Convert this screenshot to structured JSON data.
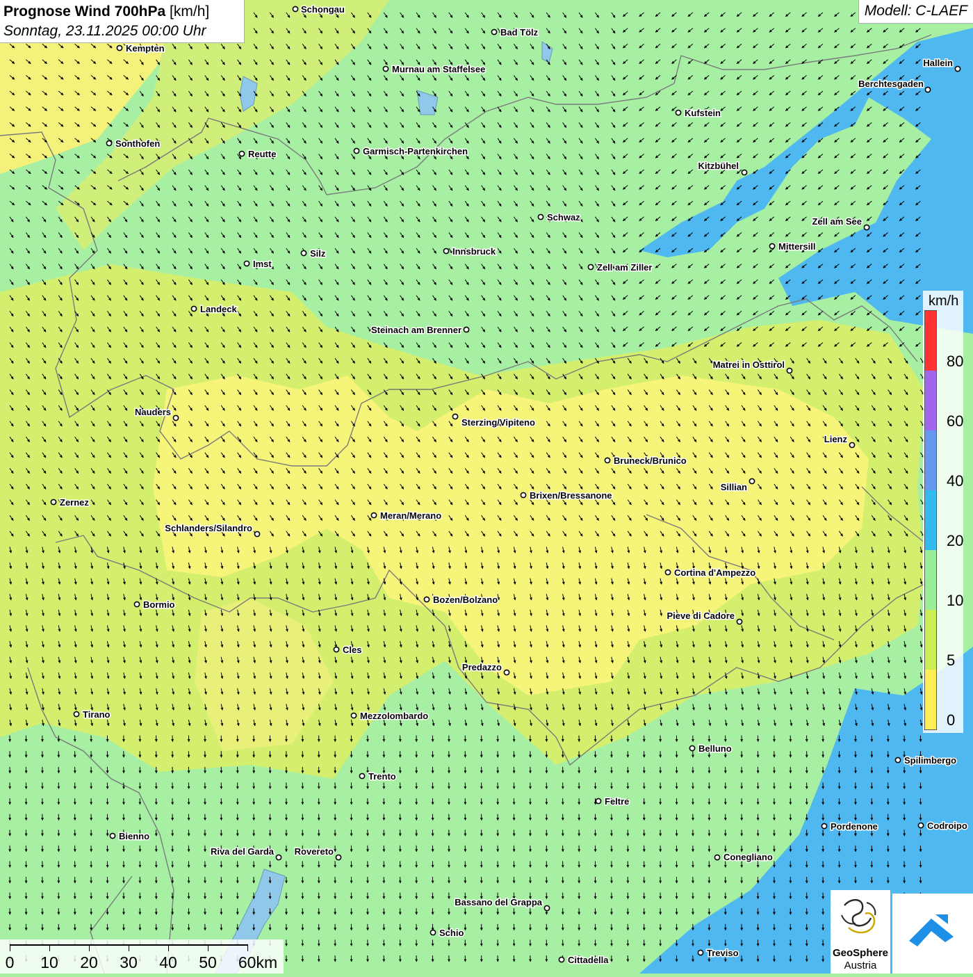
{
  "header": {
    "title": "Prognose Wind 700hPa",
    "unit": "[km/h]",
    "date": "Sonntag, 23.11.2025 00:00 Uhr",
    "model": "Modell: C-LAEF"
  },
  "legend": {
    "unit": "km/h",
    "labels": [
      "80",
      "60",
      "40",
      "20",
      "10",
      "5",
      "0"
    ],
    "colors": [
      "#ff3333",
      "#a066ee",
      "#6699ee",
      "#33bbee",
      "#99ee99",
      "#ccee55",
      "#ffee55"
    ]
  },
  "scale": {
    "labels": [
      "0",
      "10",
      "20",
      "30",
      "40",
      "50",
      "60km"
    ]
  },
  "logos": {
    "org_line1": "GeoSphere",
    "org_line2": "Austria"
  },
  "cities": [
    "Schongau",
    "Bad Tölz",
    "Kempten",
    "Murnau am Staffelsee",
    "Hallein",
    "Berchtesgaden",
    "Kufstein",
    "Sonthofen",
    "Reutte",
    "Garmisch-Partenkirchen",
    "Kitzbühel",
    "Schwaz",
    "Zell am See",
    "Mittersill",
    "Innsbruck",
    "Silz",
    "Imst",
    "Zell am Ziller",
    "Landeck",
    "Steinach am Brenner",
    "Matrei in Osttirol",
    "Nauders",
    "Sterzing/Vipiteno",
    "Lienz",
    "Bruneck/Brunico",
    "Sillian",
    "Brixen/Bressanone",
    "Zernez",
    "Meran/Merano",
    "Schlanders/Silandro",
    "Cortina d'Ampezzo",
    "Bozen/Bolzano",
    "Bormio",
    "Pieve di Cadore",
    "Cles",
    "Predazzo",
    "Tirano",
    "Mezzolombardo",
    "Belluno",
    "Spilimbergo",
    "Trento",
    "Feltre",
    "Pordenone",
    "Codroipo",
    "Bienno",
    "Riva del Garda",
    "Rovereto",
    "Conegliano",
    "Bassano del Grappa",
    "Schio",
    "Treviso",
    "Cittadella"
  ]
}
